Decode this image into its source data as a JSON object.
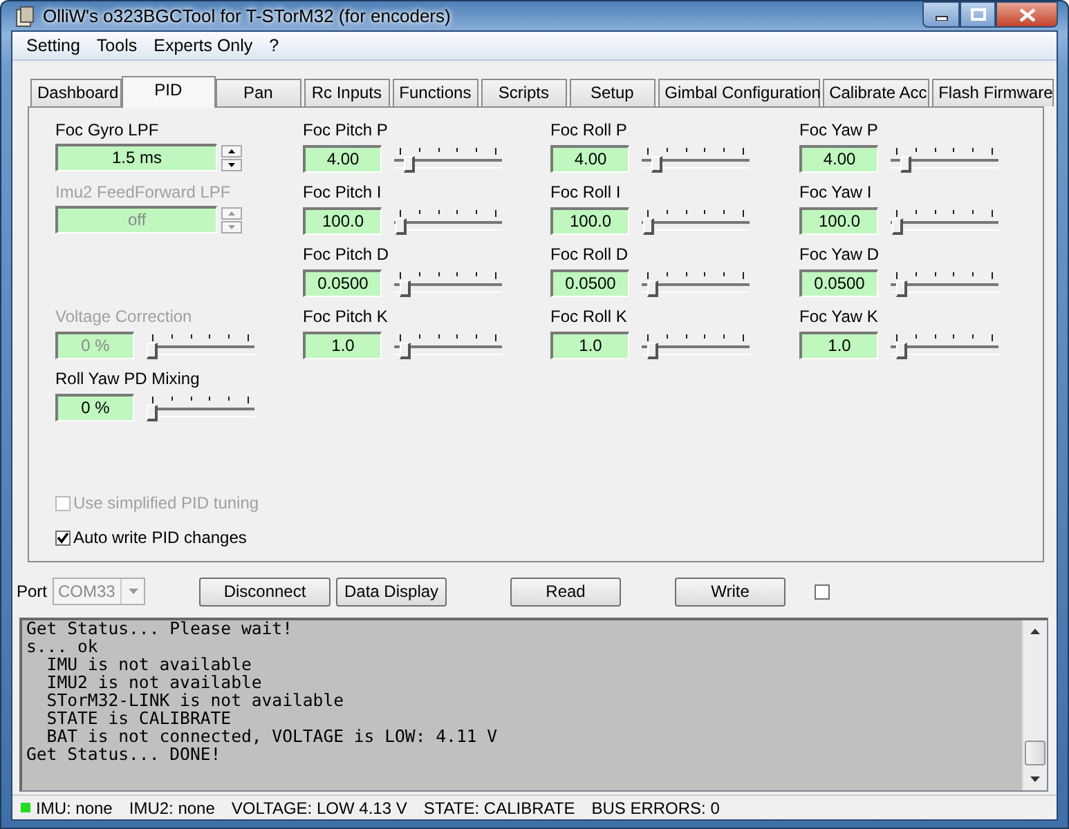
{
  "window": {
    "title": "OlliW's o323BGCTool for T-STorM32 (for encoders)"
  },
  "menu": [
    "Setting",
    "Tools",
    "Experts Only",
    "?"
  ],
  "tabs": [
    {
      "label": "Dashboard",
      "selected": false
    },
    {
      "label": "PID",
      "selected": true
    },
    {
      "label": "Pan",
      "selected": false
    },
    {
      "label": "Rc Inputs",
      "selected": false
    },
    {
      "label": "Functions",
      "selected": false
    },
    {
      "label": "Scripts",
      "selected": false
    },
    {
      "label": "Setup",
      "selected": false
    },
    {
      "label": "Gimbal Configuration",
      "selected": false
    },
    {
      "label": "Calibrate Acc",
      "selected": false
    },
    {
      "label": "Flash Firmware",
      "selected": false
    }
  ],
  "pid_columns": [
    [
      {
        "kind": "spinner",
        "label": "Foc Gyro LPF",
        "value": "1.5 ms",
        "disabled": false
      },
      {
        "kind": "spinner",
        "label": "Imu2 FeedForward LPF",
        "value": "off",
        "disabled": true
      },
      {
        "kind": "slider",
        "label": "Voltage Correction",
        "value": "0 %",
        "disabled": true,
        "level": 0
      },
      {
        "kind": "slider",
        "label": "Roll Yaw PD Mixing",
        "value": "0 %",
        "disabled": false,
        "level": 0
      }
    ],
    [
      {
        "kind": "slider",
        "label": "Foc Pitch P",
        "value": "4.00",
        "disabled": false,
        "level": 0.1
      },
      {
        "kind": "slider",
        "label": "Foc Pitch I",
        "value": "100.0",
        "disabled": false,
        "level": 0.02
      },
      {
        "kind": "slider",
        "label": "Foc Pitch D",
        "value": "0.0500",
        "disabled": false,
        "level": 0.05
      },
      {
        "kind": "slider",
        "label": "Foc Pitch K",
        "value": "1.0",
        "disabled": false,
        "level": 0.05
      }
    ],
    [
      {
        "kind": "slider",
        "label": "Foc Roll P",
        "value": "4.00",
        "disabled": false,
        "level": 0.1
      },
      {
        "kind": "slider",
        "label": "Foc Roll I",
        "value": "100.0",
        "disabled": false,
        "level": 0.02
      },
      {
        "kind": "slider",
        "label": "Foc Roll D",
        "value": "0.0500",
        "disabled": false,
        "level": 0.05
      },
      {
        "kind": "slider",
        "label": "Foc Roll K",
        "value": "1.0",
        "disabled": false,
        "level": 0.05
      }
    ],
    [
      {
        "kind": "slider",
        "label": "Foc Yaw P",
        "value": "4.00",
        "disabled": false,
        "level": 0.1
      },
      {
        "kind": "slider",
        "label": "Foc Yaw I",
        "value": "100.0",
        "disabled": false,
        "level": 0.02
      },
      {
        "kind": "slider",
        "label": "Foc Yaw D",
        "value": "0.0500",
        "disabled": false,
        "level": 0.05
      },
      {
        "kind": "slider",
        "label": "Foc Yaw K",
        "value": "1.0",
        "disabled": false,
        "level": 0.05
      }
    ]
  ],
  "options": [
    {
      "label": "Use simplified PID tuning",
      "checked": false,
      "disabled": true
    },
    {
      "label": "Auto write PID changes",
      "checked": true,
      "disabled": false
    }
  ],
  "port": {
    "label": "Port",
    "value": "COM33",
    "disabled": true
  },
  "buttons": [
    "Disconnect",
    "Data Display",
    "Read",
    "Write"
  ],
  "extra_checkbox": {
    "checked": false
  },
  "log": [
    "Get Status... Please wait!",
    "s... ok",
    "  IMU is not available",
    "  IMU2 is not available",
    "  STorM32-LINK is not available",
    "  STATE is CALIBRATE",
    "  BAT is not connected, VOLTAGE is LOW: 4.11 V",
    "Get Status... DONE!"
  ],
  "status_bar": {
    "led": {
      "color": "#22dd22"
    },
    "items": [
      "IMU: none",
      "IMU2: none",
      "VOLTAGE: LOW 4.13 V",
      "STATE: CALIBRATE",
      "BUS ERRORS: 0"
    ]
  }
}
